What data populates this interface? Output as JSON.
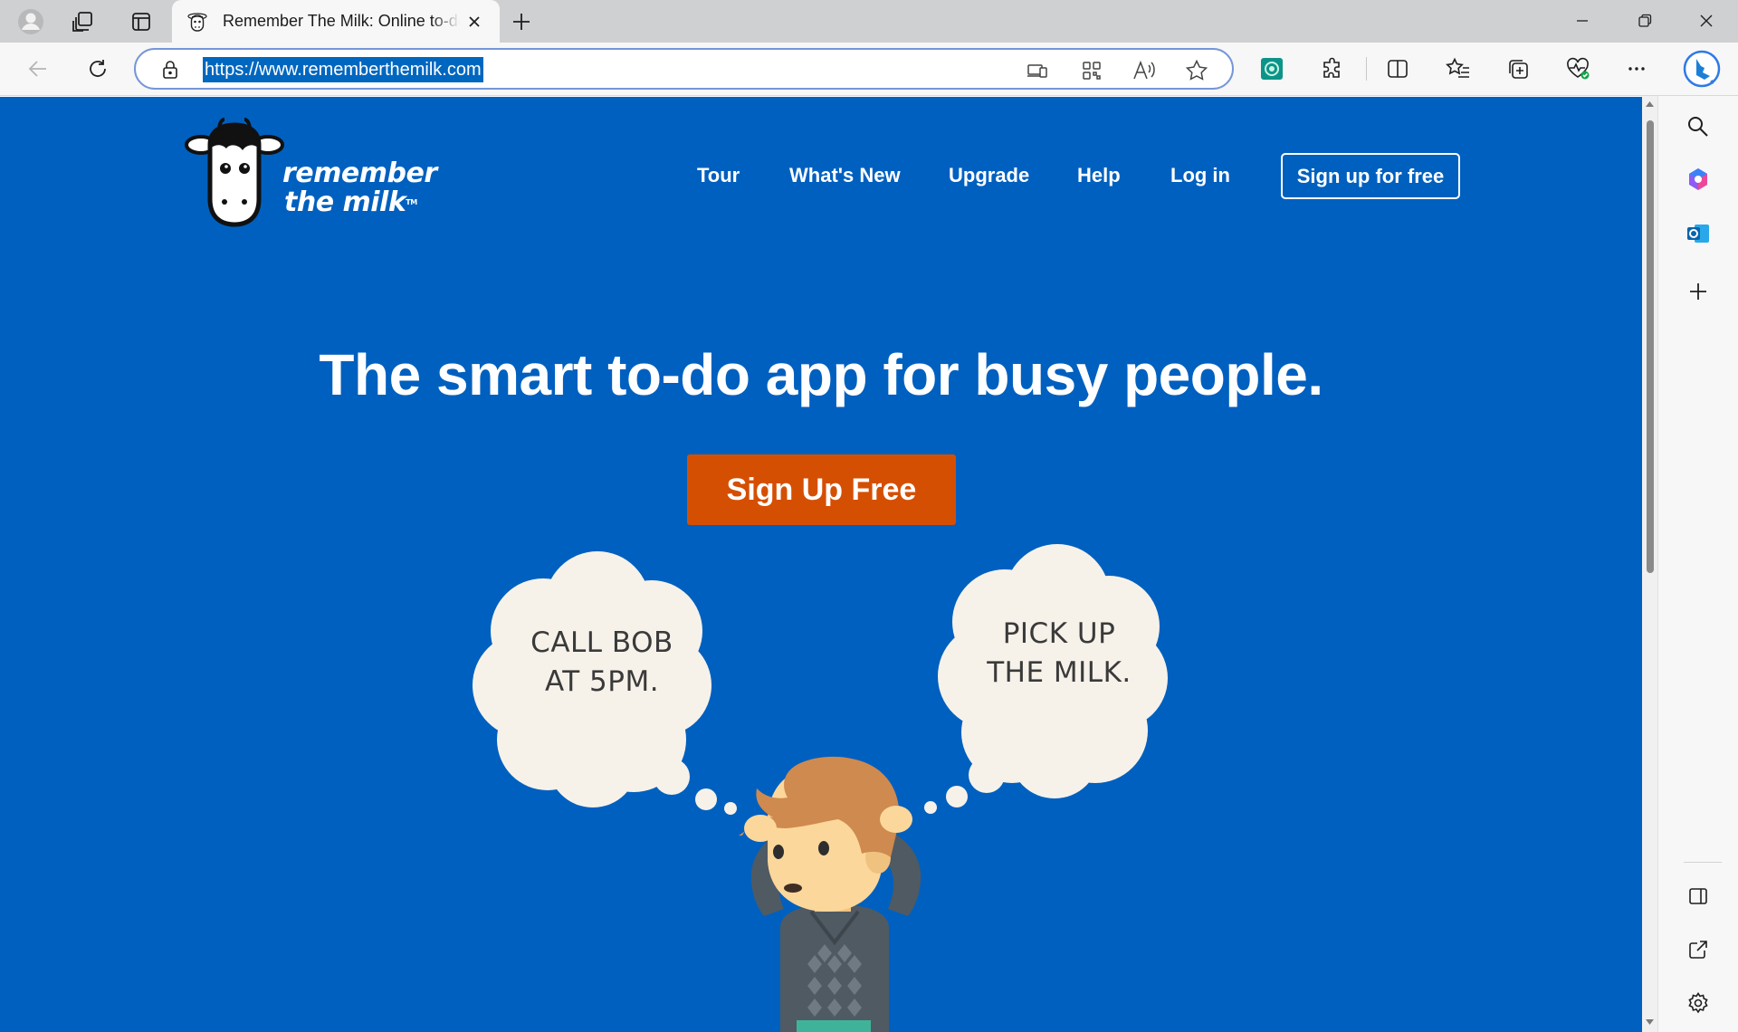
{
  "browser": {
    "tab": {
      "title": "Remember The Milk: Online to-do list and task management app"
    },
    "address": {
      "url": "https://www.rememberthemilk.com"
    },
    "icons": {
      "profile": "profile-icon",
      "workspaces": "workspaces-icon",
      "tab_actions": "tab-actions-icon",
      "back": "back-icon",
      "refresh": "refresh-icon",
      "lock": "lock-icon",
      "app_available": "app-available-icon",
      "qr": "qr-code-icon",
      "read_aloud": "read-aloud-icon",
      "favorite": "favorite-star-icon",
      "extension_green": "extension-icon",
      "extensions": "extensions-puzzle-icon",
      "split_screen": "split-screen-icon",
      "favorites": "favorites-icon",
      "collections": "collections-icon",
      "performance": "browser-essentials-icon",
      "more": "more-icon",
      "copilot": "bing-copilot-icon"
    },
    "sidebar_icons": [
      "search-icon",
      "copilot-app-icon",
      "outlook-icon",
      "add-icon",
      "hide-sidebar-icon",
      "open-external-icon",
      "settings-icon"
    ]
  },
  "site": {
    "logo": {
      "line1": "remember",
      "line2": "the milk",
      "tm": "TM"
    },
    "nav": {
      "tour": "Tour",
      "whats_new": "What's New",
      "upgrade": "Upgrade",
      "help": "Help",
      "login": "Log in",
      "signup": "Sign up for free"
    },
    "hero": {
      "headline": "The smart to-do app for busy people.",
      "cta": "Sign Up Free"
    },
    "bubbles": {
      "left": {
        "line1": "CALL BOB",
        "line2": "AT 5PM."
      },
      "right": {
        "line1": "PICK UP",
        "line2": "THE MILK."
      }
    }
  },
  "colors": {
    "page_bg": "#0060bf",
    "cta_bg": "#d54f03",
    "bubble": "#f6f2ea",
    "hair": "#cf8a4f",
    "skin": "#fcd79b",
    "sweater": "#505a62"
  }
}
